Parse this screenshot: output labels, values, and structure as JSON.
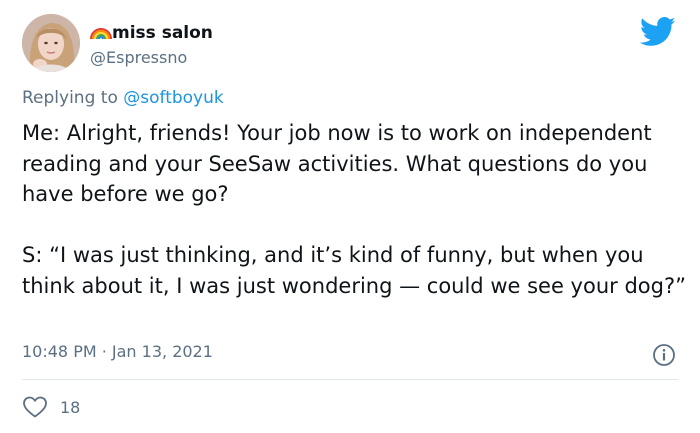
{
  "author": {
    "display_name": "miss salon",
    "handle": "@Espressno",
    "name_icon": "rainbow-icon"
  },
  "reply": {
    "prefix": "Replying to ",
    "handle": "@softboyuk"
  },
  "body": {
    "paragraph_1": "Me: Alright, friends! Your job now is to work on independent reading and your SeeSaw activities. What questions do you have before we go?",
    "paragraph_2": "S: “I was just thinking, and it’s kind of funny, but when you think about it, I was just wondering — could we see your dog?”"
  },
  "meta": {
    "timestamp": "10:48 PM · Jan 13, 2021"
  },
  "actions": {
    "like_count": "18"
  },
  "colors": {
    "twitter_blue": "#1da1f2",
    "link_blue": "#1b95e0",
    "secondary_text": "#5b7083",
    "divider": "#e1e8ed"
  }
}
